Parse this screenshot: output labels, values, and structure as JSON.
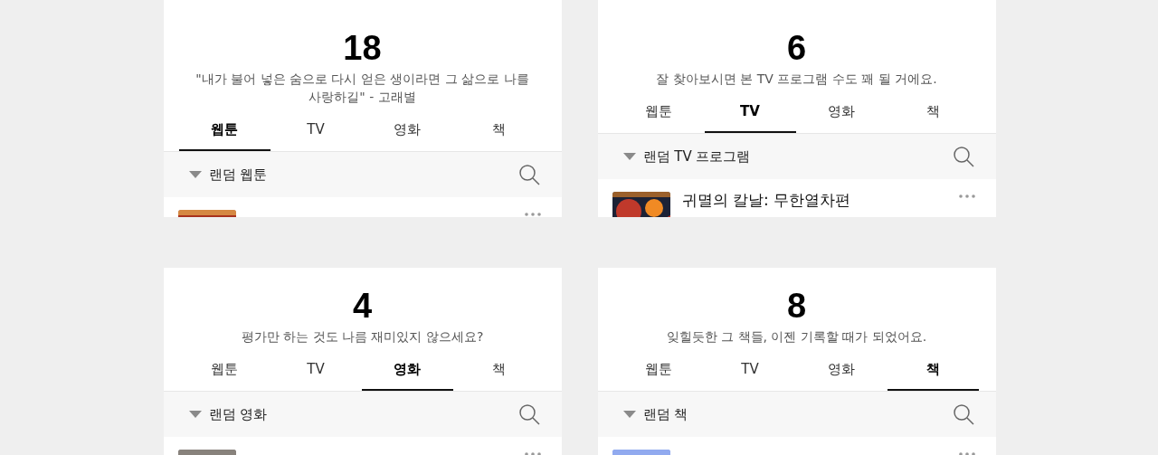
{
  "cards": [
    {
      "count": "18",
      "message": "\"내가 불어 넣은 숨으로 다시 얻은 생이라면 그 삶으로 나를 사랑하길\" - 고래별",
      "tabs": [
        {
          "label": "웹툰",
          "selected": true
        },
        {
          "label": "TV",
          "selected": false
        },
        {
          "label": "영화",
          "selected": false
        },
        {
          "label": "책",
          "selected": false
        }
      ],
      "section": {
        "title": "랜덤 웹툰",
        "expanded": true
      }
    },
    {
      "count": "6",
      "message": "잘 찾아보시면 본 TV 프로그램 수도 꽤 될 거에요.",
      "tabs": [
        {
          "label": "웹툰",
          "selected": false
        },
        {
          "label": "TV",
          "selected": true
        },
        {
          "label": "영화",
          "selected": false
        },
        {
          "label": "책",
          "selected": false
        }
      ],
      "section": {
        "title": "랜덤 TV 프로그램",
        "expanded": true
      },
      "item": {
        "title": "귀멸의 칼날: 무한열차편"
      }
    },
    {
      "count": "4",
      "message": "평가만 하는 것도 나름 재미있지 않으세요?",
      "tabs": [
        {
          "label": "웹툰",
          "selected": false
        },
        {
          "label": "TV",
          "selected": false
        },
        {
          "label": "영화",
          "selected": true
        },
        {
          "label": "책",
          "selected": false
        }
      ],
      "section": {
        "title": "랜덤 영화",
        "expanded": true
      }
    },
    {
      "count": "8",
      "message": "잊힐듯한 그 책들, 이젠 기록할 때가 되었어요.",
      "tabs": [
        {
          "label": "웹툰",
          "selected": false
        },
        {
          "label": "TV",
          "selected": false
        },
        {
          "label": "영화",
          "selected": false
        },
        {
          "label": "책",
          "selected": true
        }
      ],
      "section": {
        "title": "랜덤 책",
        "expanded": true
      }
    }
  ]
}
